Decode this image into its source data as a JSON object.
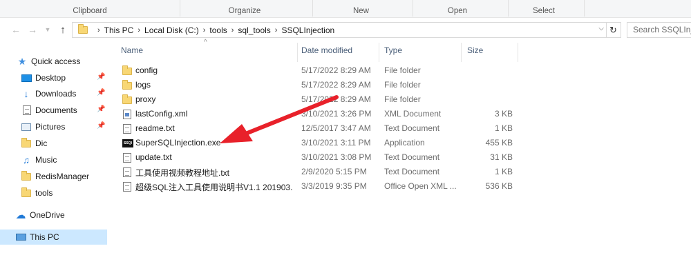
{
  "ribbon": {
    "groups": [
      "Clipboard",
      "Organize",
      "New",
      "Open",
      "Select"
    ]
  },
  "nav": {
    "back_icon": "arrow-left-icon",
    "forward_icon": "arrow-right-icon",
    "recent_icon": "chevron-down-icon",
    "up_icon": "arrow-up-icon",
    "breadcrumbs": [
      "This PC",
      "Local Disk (C:)",
      "tools",
      "sql_tools",
      "SSQLInjection"
    ],
    "search_placeholder": "Search SSQLInje"
  },
  "sidebar": {
    "items": [
      {
        "label": "Quick access",
        "icon": "star-icon",
        "pinned": false
      },
      {
        "label": "Desktop",
        "icon": "desktop-icon",
        "pinned": true
      },
      {
        "label": "Downloads",
        "icon": "download-icon",
        "pinned": true
      },
      {
        "label": "Documents",
        "icon": "documents-icon",
        "pinned": true
      },
      {
        "label": "Pictures",
        "icon": "pictures-icon",
        "pinned": true
      },
      {
        "label": "Dic",
        "icon": "folder-icon",
        "pinned": false
      },
      {
        "label": "Music",
        "icon": "music-icon",
        "pinned": false
      },
      {
        "label": "RedisManager",
        "icon": "folder-icon",
        "pinned": false
      },
      {
        "label": "tools",
        "icon": "folder-icon",
        "pinned": false
      },
      {
        "label": "OneDrive",
        "icon": "cloud-icon",
        "pinned": false
      },
      {
        "label": "This PC",
        "icon": "computer-icon",
        "pinned": false
      }
    ]
  },
  "columns": {
    "name": "Name",
    "date": "Date modified",
    "type": "Type",
    "size": "Size"
  },
  "files": [
    {
      "name": "config",
      "date": "5/17/2022 8:29 AM",
      "type": "File folder",
      "size": "",
      "icon": "folder-icon"
    },
    {
      "name": "logs",
      "date": "5/17/2022 8:29 AM",
      "type": "File folder",
      "size": "",
      "icon": "folder-icon"
    },
    {
      "name": "proxy",
      "date": "5/17/2022 8:29 AM",
      "type": "File folder",
      "size": "",
      "icon": "folder-icon"
    },
    {
      "name": "lastConfig.xml",
      "date": "3/10/2021 3:26 PM",
      "type": "XML Document",
      "size": "3 KB",
      "icon": "xml-file-icon"
    },
    {
      "name": "readme.txt",
      "date": "12/5/2017 3:47 AM",
      "type": "Text Document",
      "size": "1 KB",
      "icon": "text-file-icon"
    },
    {
      "name": "SuperSQLInjection.exe",
      "date": "3/10/2021 3:11 PM",
      "type": "Application",
      "size": "455 KB",
      "icon": "exe-icon"
    },
    {
      "name": "update.txt",
      "date": "3/10/2021 3:08 PM",
      "type": "Text Document",
      "size": "31 KB",
      "icon": "text-file-icon"
    },
    {
      "name": "工具使用视频教程地址.txt",
      "date": "2/9/2020 5:15 PM",
      "type": "Text Document",
      "size": "1 KB",
      "icon": "text-file-icon"
    },
    {
      "name": "超级SQL注入工具使用说明书V1.1 201903...",
      "date": "3/3/2019 9:35 PM",
      "type": "Office Open XML ...",
      "size": "536 KB",
      "icon": "docx-file-icon"
    }
  ],
  "exe_badge": "SSQI",
  "colors": {
    "selection": "#cce8ff",
    "folder": "#f8d775",
    "arrow": "#e8212a",
    "header_text": "#4c607a"
  }
}
